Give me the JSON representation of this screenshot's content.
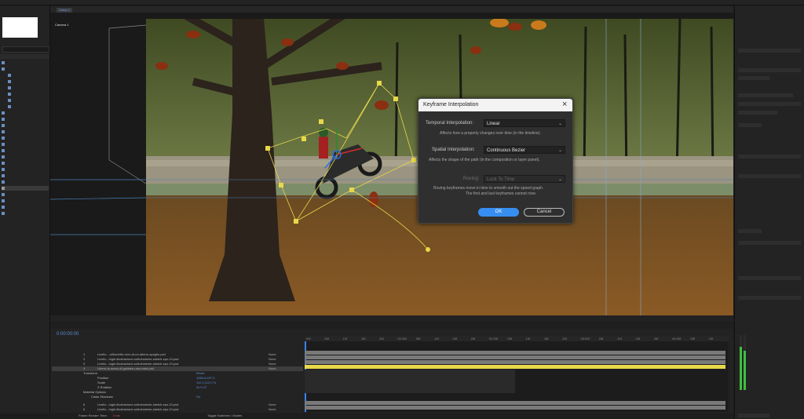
{
  "comp_tabs": [
    "Comp 1"
  ],
  "viewer": {
    "camera_label": "Camera 1"
  },
  "timeline": {
    "timecode": "0:00:00:00",
    "layers": [
      {
        "num": "1",
        "name": "Livello...-silhouette-nero-di-un-albero-spoglio.psd",
        "mode": "None"
      },
      {
        "num": "2",
        "name": "Livello...ingle-illustrazione-sottoinsieme-sketch-eps-10.psd",
        "mode": "None"
      },
      {
        "num": "3",
        "name": "Livello...ingle-illustrazione-sottoinsieme-sketch-eps-10.psd",
        "mode": "None"
      },
      {
        "num": "4",
        "name": "Libero-la-mano-di-guidare-una-moto.psd",
        "mode": "None"
      }
    ],
    "props": [
      {
        "name": "Transform",
        "value": "Reset"
      },
      {
        "name": "Position",
        "value": "1060.8,497.3"
      },
      {
        "name": "Scale",
        "value": "112.0,112.0 %"
      },
      {
        "name": "Z Rotation",
        "value": "0x+0.0°"
      },
      {
        "name": "Material Options",
        "value": ""
      },
      {
        "name": "Casts Shadows",
        "value": "On"
      }
    ],
    "bottom_layers": [
      {
        "num": "5",
        "name": "Livello...ingle-illustrazione-sottoinsieme-sketch-eps-10.psd",
        "mode": "None"
      },
      {
        "num": "6",
        "name": "Livello...ingle-illustrazione-sottoinsieme-sketch-eps-10.psd",
        "mode": "None"
      }
    ],
    "ruler": [
      "00f",
      "05f",
      "10f",
      "15f",
      "20f",
      "01:00f",
      "05f",
      "10f",
      "15f",
      "20f",
      "02:00f",
      "05f",
      "10f",
      "15f",
      "20f",
      "03:00f",
      "05f",
      "10f",
      "15f",
      "20f",
      "04:00f",
      "05f",
      "10f"
    ],
    "status_left": "Frame Render Time:",
    "status_value": "0 ms",
    "status_center": "Toggle Switches / Modes"
  },
  "dialog": {
    "title": "Keyframe Interpolation",
    "temporal_label": "Temporal Interpolation:",
    "temporal_value": "Linear",
    "temporal_desc": "Affects how a property changes over time (in the timeline).",
    "spatial_label": "Spatial Interpolation:",
    "spatial_value": "Continuous Bezier",
    "spatial_desc": "Affects the shape of the path (in the composition or layer panel).",
    "roving_label": "Roving:",
    "roving_value": "Lock To Time",
    "roving_desc_1": "Roving keyframes move in time to smooth out the speed graph.",
    "roving_desc_2": "The first and last keyframes cannot rove.",
    "ok_label": "OK",
    "cancel_label": "Cancel"
  },
  "colors": {
    "accent_blue": "#378ef0",
    "keyframe_yellow": "#e8d84a",
    "timecode_blue": "#5b8bd6"
  }
}
